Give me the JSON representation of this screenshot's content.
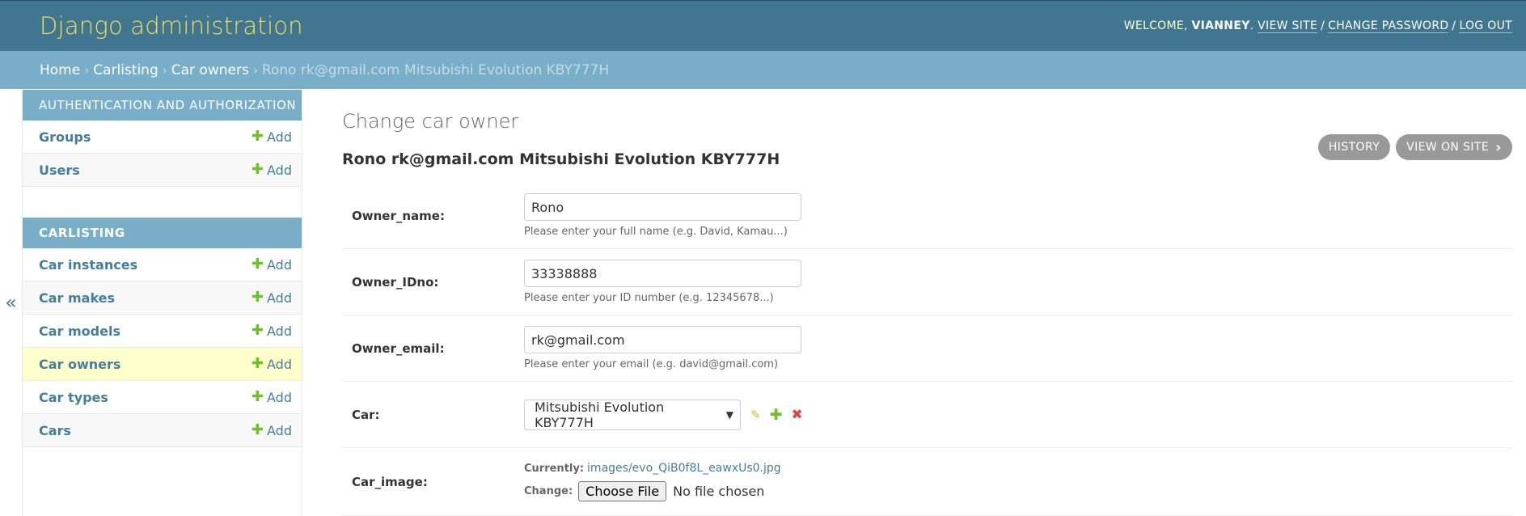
{
  "header": {
    "branding": "Django administration",
    "welcome": "WELCOME,",
    "username": "VIANNEY",
    "view_site": "VIEW SITE",
    "change_password": "CHANGE PASSWORD",
    "log_out": "LOG OUT"
  },
  "breadcrumbs": {
    "home": "Home",
    "app": "Carlisting",
    "model": "Car owners",
    "current": "Rono rk@gmail.com Mitsubishi Evolution KBY777H"
  },
  "sidebar": {
    "toggle": "«",
    "modules": [
      {
        "caption": "AUTHENTICATION AND AUTHORIZATION",
        "items": [
          {
            "label": "Groups",
            "add": "Add"
          },
          {
            "label": "Users",
            "add": "Add"
          }
        ]
      },
      {
        "caption": "CARLISTING",
        "items": [
          {
            "label": "Car instances",
            "add": "Add"
          },
          {
            "label": "Car makes",
            "add": "Add"
          },
          {
            "label": "Car models",
            "add": "Add"
          },
          {
            "label": "Car owners",
            "add": "Add"
          },
          {
            "label": "Car types",
            "add": "Add"
          },
          {
            "label": "Cars",
            "add": "Add"
          }
        ]
      }
    ]
  },
  "content": {
    "page_title": "Change car owner",
    "object_title": "Rono rk@gmail.com Mitsubishi Evolution KBY777H",
    "history": "HISTORY",
    "view_on_site": "VIEW ON SITE",
    "fields": {
      "owner_name": {
        "label": "Owner_name:",
        "value": "Rono",
        "help": "Please enter your full name (e.g. David, Kamau...)"
      },
      "owner_idno": {
        "label": "Owner_IDno:",
        "value": "33338888",
        "help": "Please enter your ID number (e.g. 12345678...)"
      },
      "owner_email": {
        "label": "Owner_email:",
        "value": "rk@gmail.com",
        "help": "Please enter your email (e.g. david@gmail.com)"
      },
      "car": {
        "label": "Car:",
        "value": "Mitsubishi Evolution KBY777H"
      },
      "car_image": {
        "label": "Car_image:",
        "currently_label": "Currently:",
        "currently_value": "images/evo_QiB0f8L_eawxUs0.jpg",
        "change_label": "Change:",
        "choose_file": "Choose File",
        "no_file": "No file chosen"
      }
    }
  },
  "colors": {
    "header_bg": "#417690",
    "branding": "#f5dd5d",
    "breadcrumbs_bg": "#79aec8",
    "link": "#447e9b",
    "add_green": "#70bf2b",
    "delete_red": "#dd4646",
    "current_row_bg": "#ffffcc"
  },
  "icons": {
    "add": "plus-icon",
    "edit": "pencil-icon",
    "delete": "cross-icon",
    "view_on_site": "chevron-right-icon",
    "sidebar_toggle": "double-chevron-left-icon"
  }
}
